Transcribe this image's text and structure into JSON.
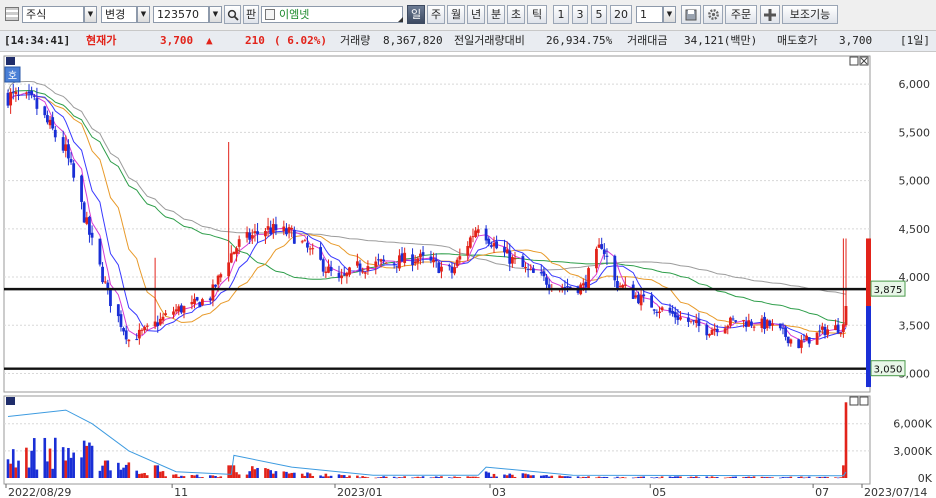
{
  "toolbar": {
    "market": "주식",
    "change_mode": "변경",
    "code": "123570",
    "pan_label": "판",
    "stock_name": "이엠넷",
    "periods": [
      "일",
      "주",
      "월",
      "년",
      "분",
      "초",
      "틱"
    ],
    "active_period": "일",
    "intervals": [
      "1",
      "3",
      "5",
      "20"
    ],
    "count_value": "1",
    "order_label": "주문",
    "aux_label": "보조기능"
  },
  "infobar": {
    "time": "[14:34:41]",
    "price_label": "현재가",
    "price": "3,700",
    "change_arrow": "▲",
    "change": "210",
    "change_pct": "( 6.02%)",
    "volume_label": "거래량",
    "volume": "8,367,820",
    "prev_ratio_label": "전일거래량대비",
    "prev_ratio": "26,934.75%",
    "amount_label": "거래대금",
    "amount": "34,121(백만)",
    "ask_label": "매도호가",
    "ask": "3,700",
    "period_tag": "[1일]"
  },
  "price_panel": {
    "corner_label": "호",
    "y_ticks": [
      "6,000",
      "5,500",
      "5,000",
      "4,500",
      "4,000",
      "3,500",
      "3,000"
    ],
    "hlines": [
      "3,875",
      "3,050"
    ]
  },
  "volume_panel": {
    "y_ticks": [
      "6,000K",
      "3,000K",
      "0K"
    ]
  },
  "x_labels": [
    "2022/08/29",
    "11",
    "2023/01",
    "03",
    "05",
    "07",
    "2023/07/14"
  ],
  "colors": {
    "up": "#e2231a",
    "down": "#1a2fd6",
    "ma5": "#d63bd6",
    "ma10": "#3a3aff",
    "ma20": "#e89a2a",
    "ma60": "#2e9e4a",
    "ma120": "#9c9c9c",
    "volume_ma": "#3d9be0",
    "hline": "#111111"
  },
  "chart_data": {
    "type": "candlestick",
    "x_start": "2022/08/29",
    "x_end": "2023/07/14",
    "price_range": [
      2850,
      6250
    ],
    "horizontal_lines": [
      3875,
      3050
    ],
    "last": {
      "open": 3500,
      "high": 4400,
      "low": 3480,
      "close": 3700,
      "volume": 8367820
    },
    "close_path": [
      {
        "date": "2022/08/29",
        "close": 5880
      },
      {
        "date": "2022/09/08",
        "close": 5800
      },
      {
        "date": "2022/09/20",
        "close": 5300
      },
      {
        "date": "2022/09/30",
        "close": 4350
      },
      {
        "date": "2022/10/07",
        "close": 3750
      },
      {
        "date": "2022/10/14",
        "close": 3350
      },
      {
        "date": "2022/10/21",
        "close": 3450
      },
      {
        "date": "2022/10/31",
        "close": 3650
      },
      {
        "date": "2022/11/07",
        "close": 3700
      },
      {
        "date": "2022/11/14",
        "close": 3800
      },
      {
        "date": "2022/11/21",
        "close": 4200
      },
      {
        "date": "2022/11/25",
        "close": 4350
      },
      {
        "date": "2022/12/05",
        "close": 4500
      },
      {
        "date": "2022/12/15",
        "close": 4450
      },
      {
        "date": "2022/12/26",
        "close": 4150
      },
      {
        "date": "2023/01/02",
        "close": 3950
      },
      {
        "date": "2023/01/09",
        "close": 4100
      },
      {
        "date": "2023/01/20",
        "close": 4150
      },
      {
        "date": "2023/02/01",
        "close": 4200
      },
      {
        "date": "2023/02/14",
        "close": 4050
      },
      {
        "date": "2023/02/24",
        "close": 4550
      },
      {
        "date": "2023/03/03",
        "close": 4300
      },
      {
        "date": "2023/03/15",
        "close": 4050
      },
      {
        "date": "2023/03/27",
        "close": 3900
      },
      {
        "date": "2023/04/05",
        "close": 3900
      },
      {
        "date": "2023/04/12",
        "close": 4350
      },
      {
        "date": "2023/04/17",
        "close": 3950
      },
      {
        "date": "2023/04/28",
        "close": 3750
      },
      {
        "date": "2023/05/10",
        "close": 3600
      },
      {
        "date": "2023/05/22",
        "close": 3450
      },
      {
        "date": "2023/06/02",
        "close": 3550
      },
      {
        "date": "2023/06/15",
        "close": 3500
      },
      {
        "date": "2023/06/26",
        "close": 3300
      },
      {
        "date": "2023/07/06",
        "close": 3450
      },
      {
        "date": "2023/07/13",
        "close": 3490
      },
      {
        "date": "2023/07/14",
        "close": 3700
      }
    ],
    "spikes": [
      {
        "date": "2022/11/22",
        "high": 5400
      },
      {
        "date": "2022/10/24",
        "high": 4200
      },
      {
        "date": "2023/07/14",
        "high": 4400
      }
    ],
    "volume_ma_path": [
      {
        "date": "2022/08/29",
        "volume_k": 6800
      },
      {
        "date": "2022/09/20",
        "volume_k": 7500
      },
      {
        "date": "2022/09/30",
        "volume_k": 6000
      },
      {
        "date": "2022/10/14",
        "volume_k": 3000
      },
      {
        "date": "2022/11/01",
        "volume_k": 700
      },
      {
        "date": "2022/11/22",
        "volume_k": 400
      },
      {
        "date": "2022/11/23",
        "volume_k": 2500
      },
      {
        "date": "2022/12/15",
        "volume_k": 1200
      },
      {
        "date": "2023/01/15",
        "volume_k": 300
      },
      {
        "date": "2023/02/24",
        "volume_k": 300
      },
      {
        "date": "2023/02/27",
        "volume_k": 1200
      },
      {
        "date": "2023/04/01",
        "volume_k": 300
      },
      {
        "date": "2023/07/13",
        "volume_k": 250
      },
      {
        "date": "2023/07/14",
        "volume_k": 650
      }
    ],
    "volume_range_k": [
      0,
      8400
    ],
    "moving_averages": [
      "ma5",
      "ma10",
      "ma20",
      "ma60",
      "ma120"
    ]
  }
}
